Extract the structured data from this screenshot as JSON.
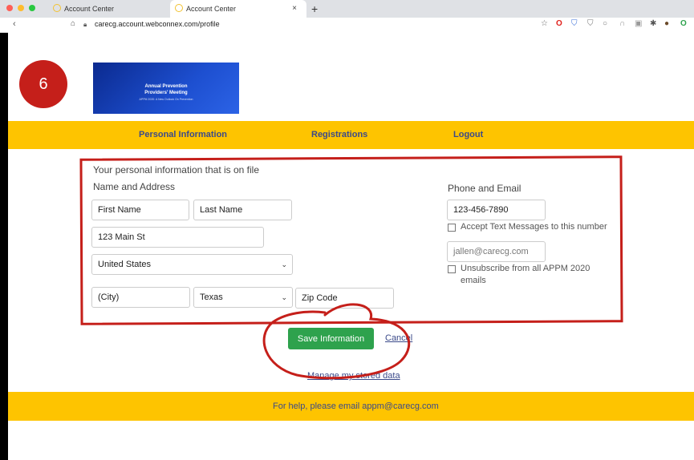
{
  "step_badge": "6",
  "browser": {
    "tabs": [
      {
        "label": "Account Center",
        "active": false
      },
      {
        "label": "Account Center",
        "active": true
      }
    ],
    "new_tab": "+",
    "url": "carecg.account.webconnex.com/profile"
  },
  "banner": {
    "line1": "Annual Prevention",
    "line2": "Providers' Meeting",
    "tagline": "APPM 2020: A New Outlook On Prevention"
  },
  "nav": {
    "personal": "Personal Information",
    "registrations": "Registrations",
    "logout": "Logout"
  },
  "form": {
    "intro": "Your personal information that is on file",
    "name_address_title": "Name and Address",
    "first_name": "First Name",
    "last_name": "Last Name",
    "address": "123 Main St",
    "country": "United States",
    "city": "(City)",
    "state": "Texas",
    "zip": "Zip Code",
    "phone_email_title": "Phone and Email",
    "phone": "123-456-7890",
    "accept_text": "Accept Text Messages to this number",
    "email": "jallen@carecg.com",
    "unsubscribe": "Unsubscribe from all APPM 2020 emails"
  },
  "actions": {
    "save": "Save Information",
    "cancel": "Cancel",
    "manage": "Manage my stored data"
  },
  "footer": "For help, please email appm@carecg.com",
  "colors": {
    "nav_bar": "#fec400",
    "save_button": "#2ea24d",
    "annotation_red": "#c51f1a",
    "link": "#3b4a8a"
  }
}
